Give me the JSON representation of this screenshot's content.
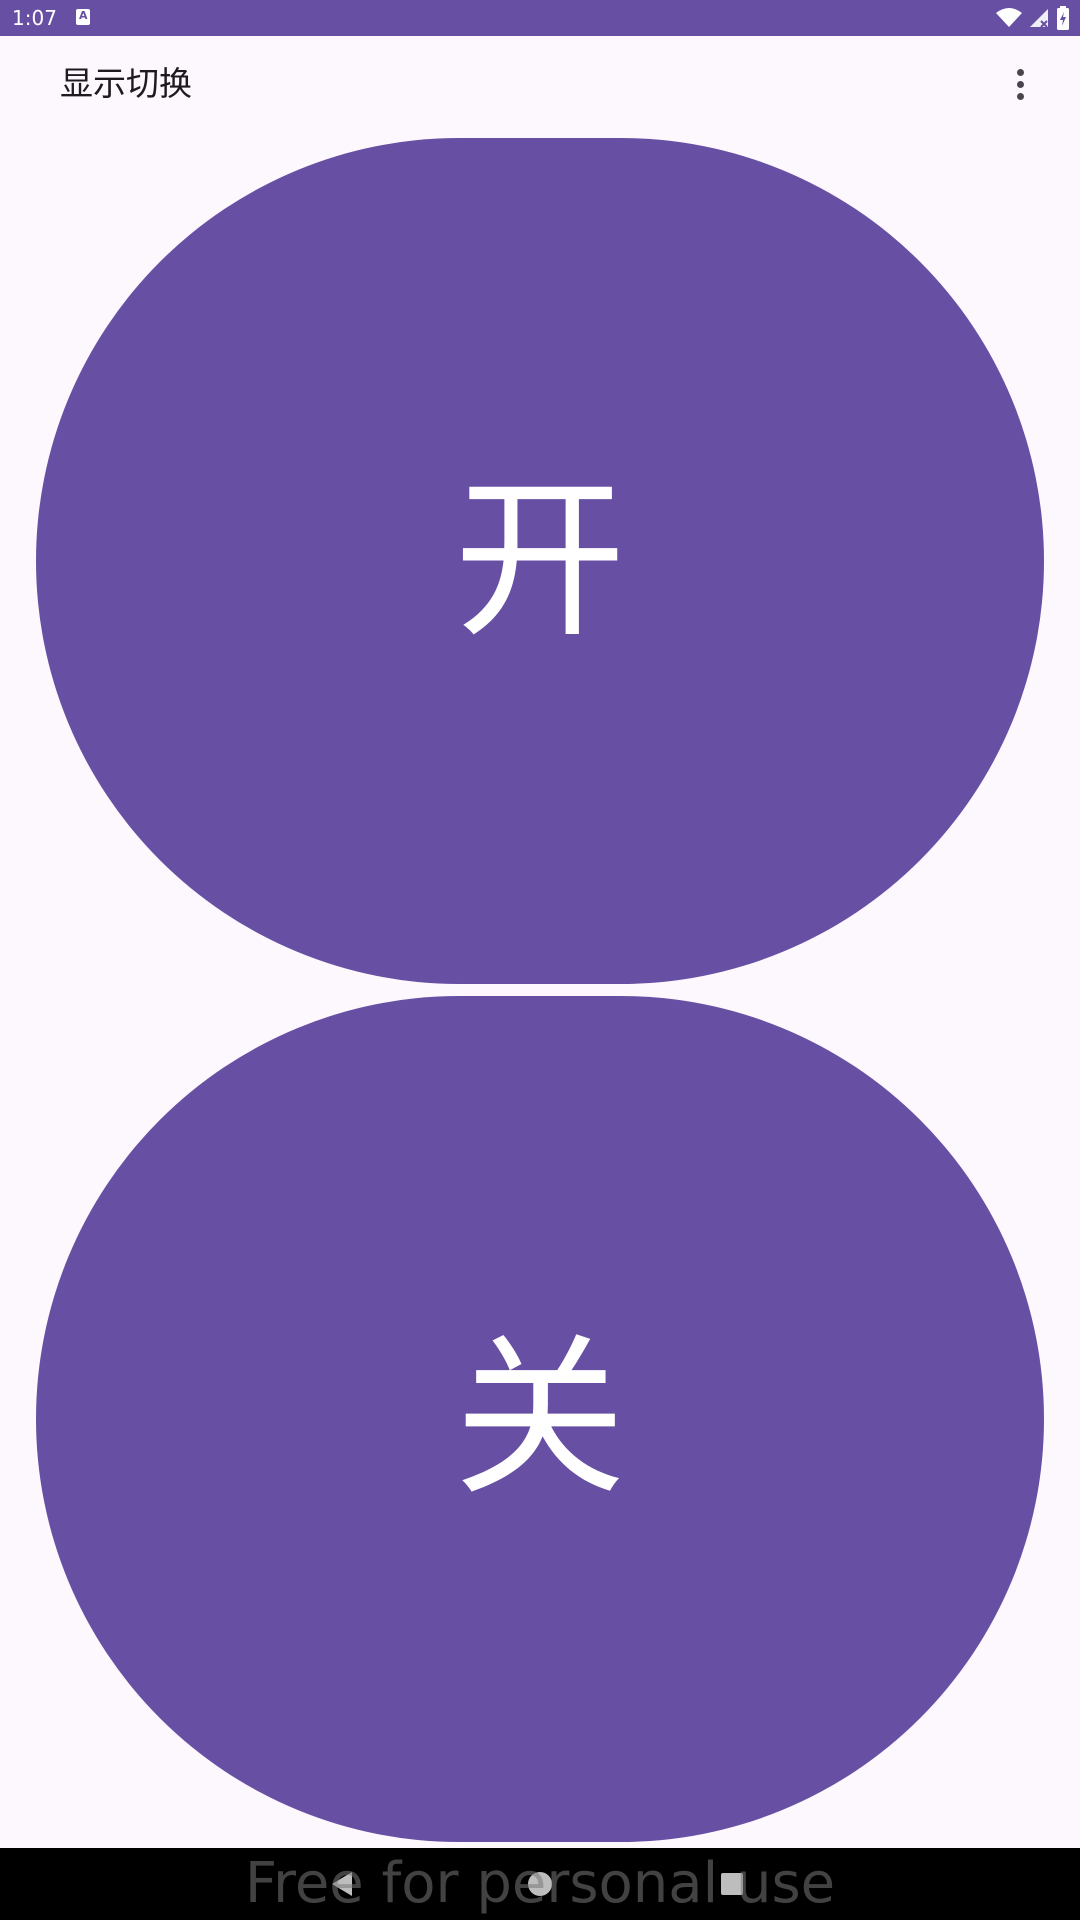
{
  "status_bar": {
    "time": "1:07",
    "notification_icon": "keyboard-a-icon",
    "icons": [
      "wifi-icon",
      "cell-signal-off-icon",
      "battery-charging-icon"
    ]
  },
  "app_bar": {
    "title": "显示切换",
    "overflow_icon": "more-vert-icon"
  },
  "buttons": {
    "on_label": "开",
    "off_label": "关"
  },
  "nav_bar": {
    "icons": [
      "back-icon",
      "home-icon",
      "recents-icon"
    ]
  },
  "watermark": "Free for personal use",
  "colors": {
    "primary": "#6750a4",
    "background": "#fdf7fe",
    "on_primary": "#ffffff"
  }
}
